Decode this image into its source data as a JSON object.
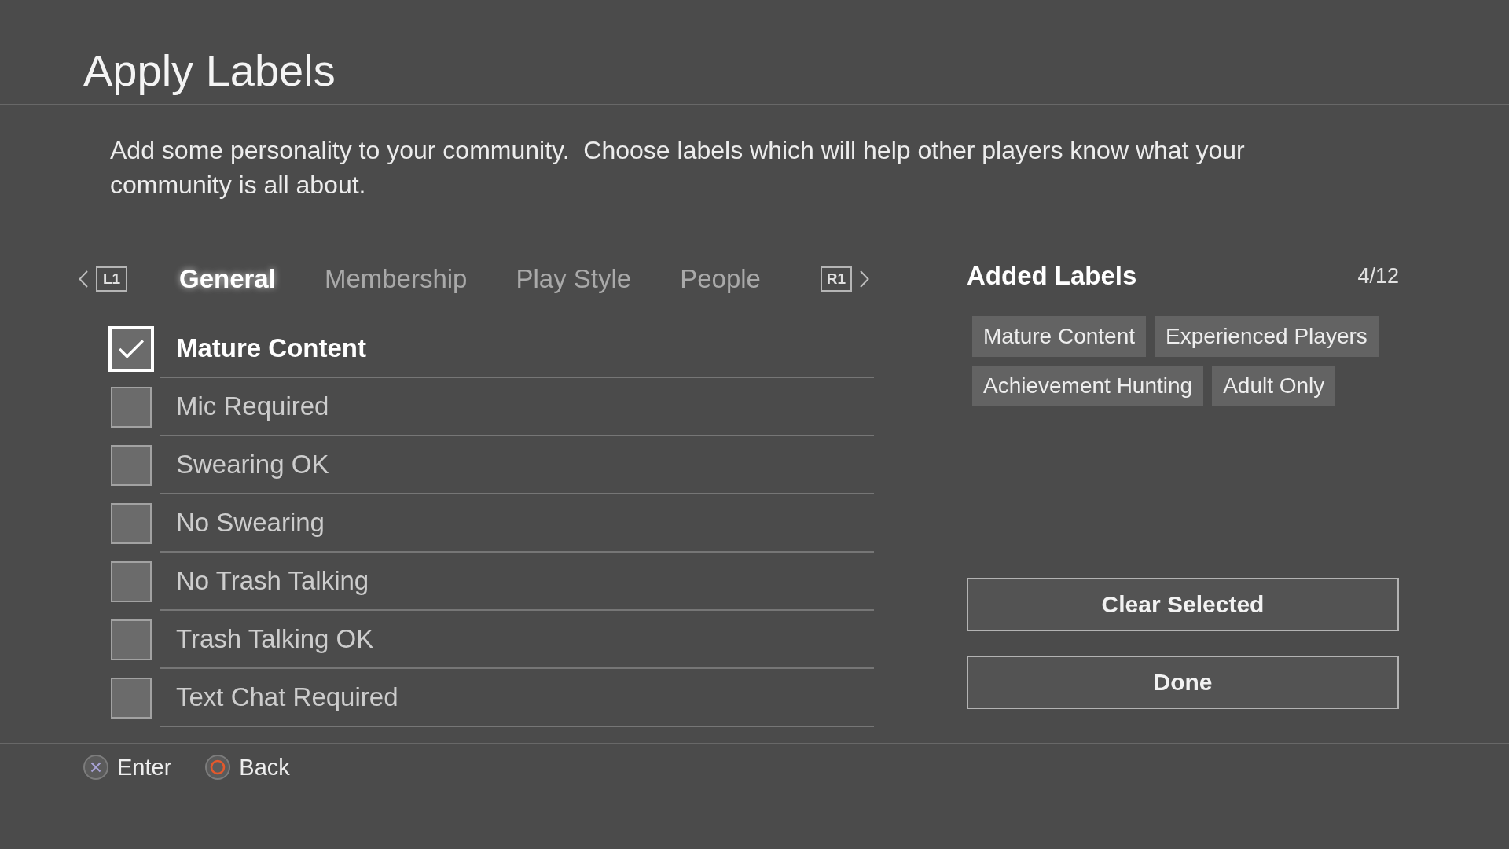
{
  "title": "Apply Labels",
  "description": "Add some personality to your community.  Choose labels which will help other players know what your community is all about.",
  "tab_bar": {
    "prev_key": "L1",
    "next_key": "R1",
    "tabs": [
      {
        "label": "General",
        "selected": true
      },
      {
        "label": "Membership",
        "selected": false
      },
      {
        "label": "Play Style",
        "selected": false
      },
      {
        "label": "People",
        "selected": false
      }
    ]
  },
  "options": [
    {
      "label": "Mature Content",
      "checked": true,
      "focused": true
    },
    {
      "label": "Mic Required",
      "checked": false,
      "focused": false
    },
    {
      "label": "Swearing OK",
      "checked": false,
      "focused": false
    },
    {
      "label": "No Swearing",
      "checked": false,
      "focused": false
    },
    {
      "label": "No Trash Talking",
      "checked": false,
      "focused": false
    },
    {
      "label": "Trash Talking OK",
      "checked": false,
      "focused": false
    },
    {
      "label": "Text Chat Required",
      "checked": false,
      "focused": false
    }
  ],
  "added_labels": {
    "title": "Added Labels",
    "count": "4/12",
    "labels": [
      "Mature Content",
      "Experienced Players",
      "Achievement Hunting",
      "Adult Only"
    ]
  },
  "buttons": [
    "Clear Selected",
    "Done"
  ],
  "footer_hints": [
    {
      "kind": "cross",
      "label": "Enter"
    },
    {
      "kind": "circle",
      "label": "Back"
    }
  ]
}
